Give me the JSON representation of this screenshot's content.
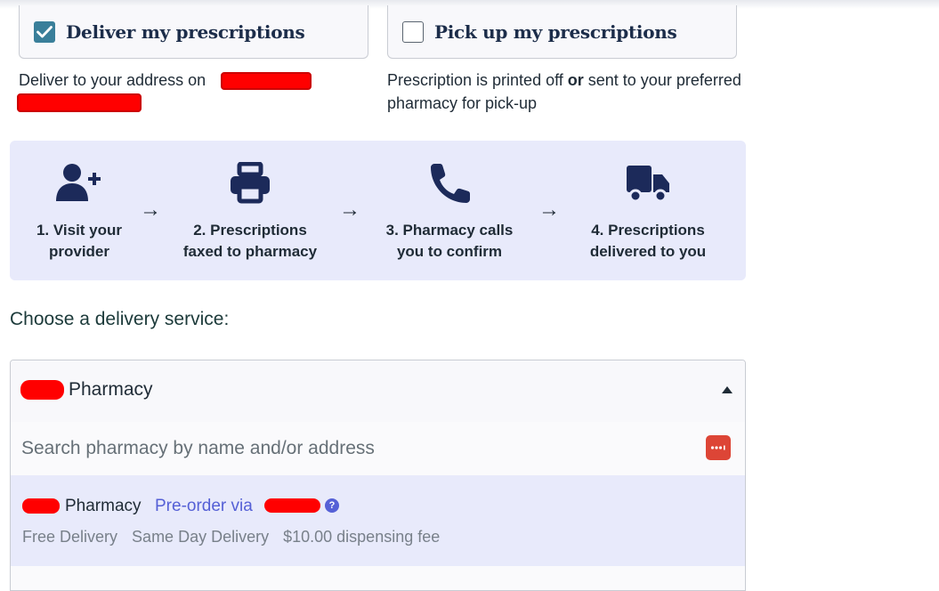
{
  "options": {
    "deliver": {
      "label": "Deliver my prescriptions",
      "checked": true,
      "description": "Deliver to your address on"
    },
    "pickup": {
      "label": "Pick up my prescriptions",
      "checked": false,
      "description_prefix": "Prescription is printed off ",
      "description_bold": "or",
      "description_suffix": " sent to your preferred pharmacy for pick-up"
    }
  },
  "steps": [
    {
      "icon": "add-user-icon",
      "line1": "1. Visit your",
      "line2": "provider"
    },
    {
      "icon": "printer-icon",
      "line1": "2. Prescriptions",
      "line2": "faxed to pharmacy"
    },
    {
      "icon": "phone-icon",
      "line1": "3. Pharmacy calls",
      "line2": "you to confirm"
    },
    {
      "icon": "truck-icon",
      "line1": "4. Prescriptions",
      "line2": "delivered to you"
    }
  ],
  "delivery": {
    "title": "Choose a delivery service:",
    "selected": "Pharmacy",
    "search_placeholder": "Search pharmacy by name and/or address",
    "results": [
      {
        "name": "Pharmacy",
        "preorder": "Pre-order via",
        "tags": [
          "Free Delivery",
          "Same Day Delivery",
          "$10.00 dispensing fee"
        ]
      }
    ]
  },
  "colors": {
    "accent": "#3a7f9a",
    "steps_bg": "#e8eafb",
    "link": "#5560d6",
    "redaction": "#ff0000"
  }
}
